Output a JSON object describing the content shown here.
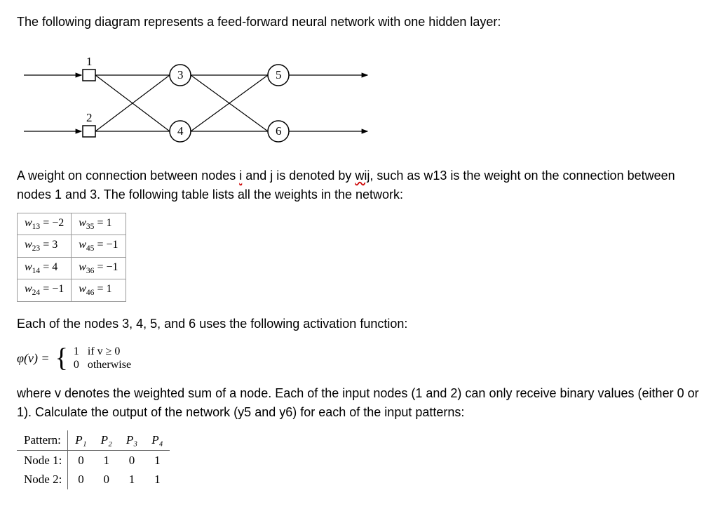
{
  "intro": "The following diagram represents a feed-forward neural network with one hidden layer:",
  "nodes": {
    "in1": "1",
    "in2": "2",
    "h3": "3",
    "h4": "4",
    "o5": "5",
    "o6": "6"
  },
  "weights_text_intro_1": "A weight on connection between nodes ",
  "weights_text_intro_i": "i",
  "weights_text_intro_2": " and j is denoted by ",
  "weights_text_intro_wij": "wij",
  "weights_text_intro_3": ", such as w13 is the weight on the connection between nodes 1 and 3. The following table lists all the weights in the network:",
  "weights": {
    "w13": "−2",
    "w35": "1",
    "w23": "3",
    "w45": "−1",
    "w14": "4",
    "w36": "−1",
    "w24": "−1",
    "w46": "1"
  },
  "activation_intro": "Each of the nodes 3, 4, 5, and 6 uses the following activation function:",
  "activation": {
    "lhs": "φ(v) =",
    "row1": "1   if v ≥ 0",
    "row2": "0   otherwise"
  },
  "tail_text": "where v denotes the weighted sum of a node. Each of the input nodes (1 and 2) can only receive binary values (either 0 or 1). Calculate the output of the network (y5 and y6) for each of the input patterns:",
  "pattern_table": {
    "head": [
      "Pattern:",
      "P₁",
      "P₂",
      "P₃",
      "P₄"
    ],
    "rows": [
      [
        "Node 1:",
        "0",
        "1",
        "0",
        "1"
      ],
      [
        "Node 2:",
        "0",
        "0",
        "1",
        "1"
      ]
    ]
  },
  "chart_data": {
    "type": "table",
    "title": "Feed-forward neural network weights and input patterns",
    "weights": {
      "w13": -2,
      "w23": 3,
      "w14": 4,
      "w24": -1,
      "w35": 1,
      "w45": -1,
      "w36": -1,
      "w46": 1
    },
    "activation": "step (1 if v>=0 else 0)",
    "patterns": {
      "P1": {
        "node1": 0,
        "node2": 0
      },
      "P2": {
        "node1": 1,
        "node2": 0
      },
      "P3": {
        "node1": 0,
        "node2": 1
      },
      "P4": {
        "node1": 1,
        "node2": 1
      }
    }
  }
}
